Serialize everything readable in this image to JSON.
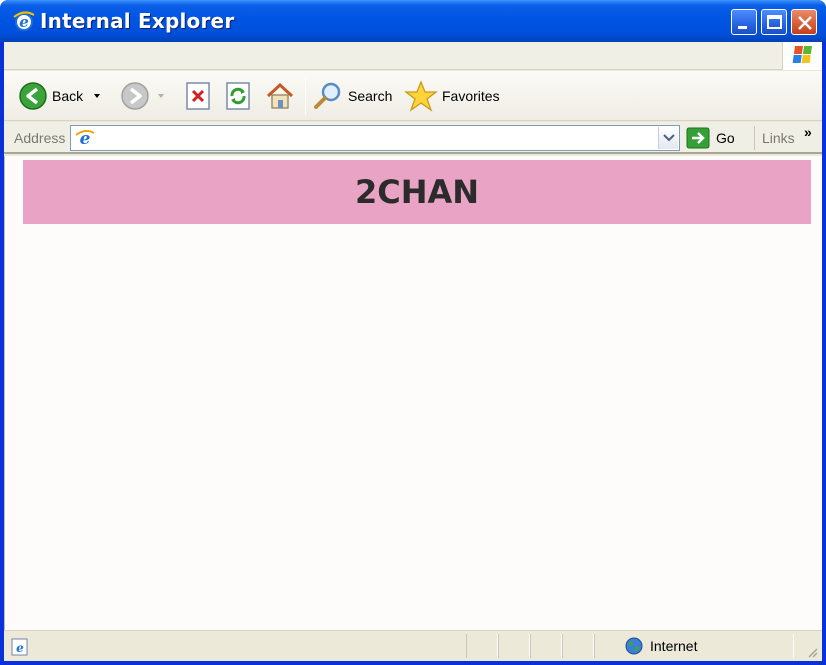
{
  "window": {
    "title": "Internal Explorer"
  },
  "toolbar": {
    "back_label": "Back",
    "search_label": "Search",
    "favorites_label": "Favorites"
  },
  "address": {
    "label": "Address",
    "value": "",
    "go_label": "Go",
    "links_label": "Links",
    "links_chevron": "»"
  },
  "page": {
    "banner_title": "2CHAN",
    "banner_color": "#e8a3c5"
  },
  "status": {
    "zone_label": "Internet"
  },
  "colors": {
    "titlebar": "#0054e3",
    "chrome": "#ece9d8"
  }
}
